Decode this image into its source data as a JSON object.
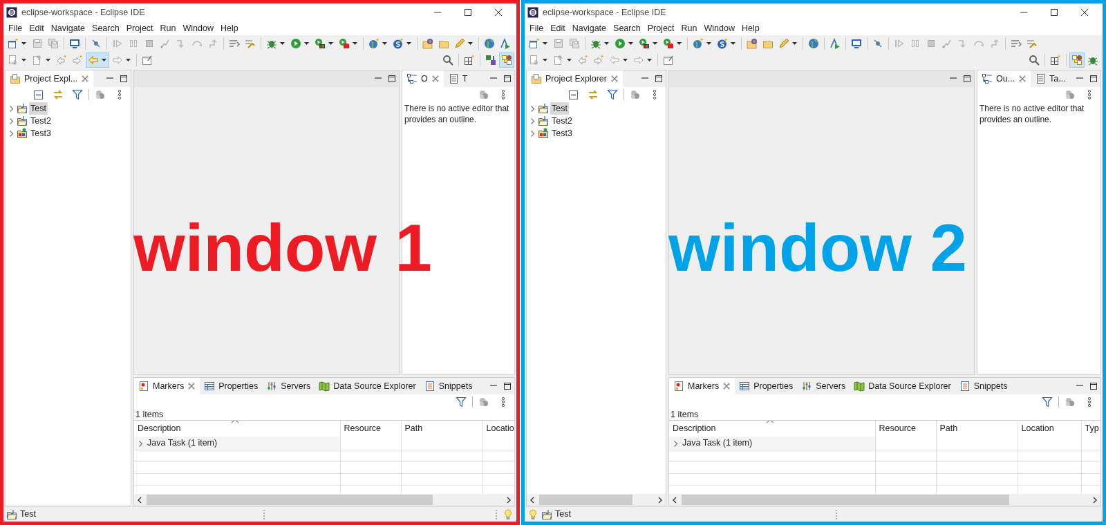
{
  "windows": [
    {
      "color": "#ed1c24",
      "title": "eclipse-workspace - Eclipse IDE",
      "menu": [
        "File",
        "Edit",
        "Navigate",
        "Search",
        "Project",
        "Run",
        "Window",
        "Help"
      ],
      "toolbar_rows": [
        [
          {
            "kind": "new",
            "menu": true,
            "pressed": false
          },
          {
            "kind": "save",
            "menu": false,
            "pressed": false
          },
          {
            "kind": "saveall",
            "menu": false,
            "pressed": false
          },
          {
            "kind": "separator"
          },
          {
            "kind": "monitor",
            "menu": false,
            "pressed": false
          },
          {
            "kind": "separator"
          },
          {
            "kind": "skip",
            "menu": false,
            "pressed": false
          },
          {
            "kind": "separator"
          },
          {
            "kind": "resume",
            "menu": false,
            "pressed": false
          },
          {
            "kind": "suspend",
            "menu": false,
            "pressed": false
          },
          {
            "kind": "stop",
            "menu": false,
            "pressed": false
          },
          {
            "kind": "disconnect",
            "menu": false,
            "pressed": false
          },
          {
            "kind": "stepinto",
            "menu": false,
            "pressed": false
          },
          {
            "kind": "stepover",
            "menu": false,
            "pressed": false
          },
          {
            "kind": "stepreturn",
            "menu": false,
            "pressed": false
          },
          {
            "kind": "separator"
          },
          {
            "kind": "wrap",
            "menu": false,
            "pressed": false
          },
          {
            "kind": "dropframe",
            "menu": false,
            "pressed": false
          },
          {
            "kind": "separator"
          },
          {
            "kind": "bug",
            "menu": true,
            "pressed": false
          },
          {
            "kind": "run",
            "menu": true,
            "pressed": false
          },
          {
            "kind": "coverage",
            "menu": true,
            "pressed": false
          },
          {
            "kind": "tools",
            "menu": true,
            "pressed": false
          },
          {
            "kind": "separator"
          },
          {
            "kind": "newproj",
            "menu": true,
            "pressed": false
          },
          {
            "kind": "newserver",
            "menu": true,
            "pressed": false
          },
          {
            "kind": "separator"
          },
          {
            "kind": "folderglobe",
            "menu": false,
            "pressed": false
          },
          {
            "kind": "folder",
            "menu": false,
            "pressed": false
          },
          {
            "kind": "pencil",
            "menu": true,
            "pressed": false
          },
          {
            "kind": "separator"
          },
          {
            "kind": "globe",
            "menu": false,
            "pressed": false
          },
          {
            "kind": "runweb",
            "menu": false,
            "pressed": false
          }
        ],
        [
          {
            "kind": "annotdown",
            "menu": true,
            "pressed": false
          },
          {
            "kind": "annotup",
            "menu": true,
            "pressed": false
          },
          {
            "kind": "backedit",
            "menu": false,
            "pressed": false
          },
          {
            "kind": "fwdedit",
            "menu": false,
            "pressed": false
          },
          {
            "kind": "back-active",
            "menu": true,
            "pressed": true
          },
          {
            "kind": "forward",
            "menu": true,
            "pressed": false
          },
          {
            "kind": "separator"
          },
          {
            "kind": "pin",
            "menu": false,
            "pressed": false
          },
          {
            "kind": "spacer"
          },
          {
            "kind": "search",
            "menu": false,
            "pressed": false
          },
          {
            "kind": "separator"
          },
          {
            "kind": "openpersp",
            "menu": false,
            "pressed": false
          },
          {
            "kind": "separator"
          },
          {
            "kind": "javapersp",
            "menu": false,
            "pressed": false
          },
          {
            "kind": "eepersp",
            "menu": false,
            "pressed": true
          }
        ]
      ],
      "explorer": {
        "tabs": [
          {
            "label": "Project Expl...",
            "selected": true
          }
        ],
        "horizontal_scrollbar": false,
        "items": [
          {
            "label": "Test",
            "kind": "project",
            "selected": true,
            "expanded": false
          },
          {
            "label": "Test2",
            "kind": "project",
            "selected": false,
            "expanded": false
          },
          {
            "label": "Test3",
            "kind": "web-project",
            "selected": false,
            "expanded": false
          }
        ]
      },
      "outline": {
        "tabs": [
          {
            "label": "O",
            "kind": "outline",
            "selected": true
          },
          {
            "label": "T",
            "kind": "tasks",
            "selected": false
          }
        ],
        "message": "There is no active editor that provides an outline."
      },
      "overlay_label": {
        "text": "window 1",
        "color": "#ed1c24"
      },
      "markers": {
        "tabs": [
          {
            "label": "Markers",
            "kind": "markers",
            "selected": true
          },
          {
            "label": "Properties",
            "kind": "properties",
            "selected": false
          },
          {
            "label": "Servers",
            "kind": "servers",
            "selected": false
          },
          {
            "label": "Data Source Explorer",
            "kind": "datasource",
            "selected": false
          },
          {
            "label": "Snippets",
            "kind": "snippets",
            "selected": false
          }
        ],
        "count": "1 items",
        "columns": [
          "Description",
          "Resource",
          "Path",
          "Locatio"
        ],
        "rows": [
          {
            "description": "Java Task (1 item)",
            "expanded": false
          }
        ]
      },
      "status_bar": {
        "text": "Test",
        "lightbulb_first": false
      }
    },
    {
      "color": "#00a2e8",
      "title": "eclipse-workspace - Eclipse IDE",
      "menu": [
        "File",
        "Edit",
        "Navigate",
        "Search",
        "Project",
        "Run",
        "Window",
        "Help"
      ],
      "toolbar_rows": [
        [
          {
            "kind": "new",
            "menu": true,
            "pressed": false
          },
          {
            "kind": "save",
            "menu": false,
            "pressed": false
          },
          {
            "kind": "saveall",
            "menu": false,
            "pressed": false
          },
          {
            "kind": "separator"
          },
          {
            "kind": "bug",
            "menu": true,
            "pressed": false
          },
          {
            "kind": "run",
            "menu": true,
            "pressed": false
          },
          {
            "kind": "coverage",
            "menu": true,
            "pressed": false
          },
          {
            "kind": "tools",
            "menu": true,
            "pressed": false
          },
          {
            "kind": "separator"
          },
          {
            "kind": "newproj",
            "menu": true,
            "pressed": false
          },
          {
            "kind": "newserver",
            "menu": true,
            "pressed": false
          },
          {
            "kind": "separator"
          },
          {
            "kind": "folderglobe",
            "menu": false,
            "pressed": false
          },
          {
            "kind": "folder",
            "menu": false,
            "pressed": false
          },
          {
            "kind": "pencil",
            "menu": true,
            "pressed": false
          },
          {
            "kind": "separator"
          },
          {
            "kind": "globe",
            "menu": false,
            "pressed": false
          },
          {
            "kind": "separator"
          },
          {
            "kind": "runweb",
            "menu": false,
            "pressed": false
          },
          {
            "kind": "separator"
          },
          {
            "kind": "monitor",
            "menu": false,
            "pressed": false
          },
          {
            "kind": "separator"
          },
          {
            "kind": "skip",
            "menu": false,
            "pressed": false
          },
          {
            "kind": "separator"
          },
          {
            "kind": "resume",
            "menu": false,
            "pressed": false
          },
          {
            "kind": "suspend",
            "menu": false,
            "pressed": false
          },
          {
            "kind": "stop",
            "menu": false,
            "pressed": false
          },
          {
            "kind": "disconnect",
            "menu": false,
            "pressed": false
          },
          {
            "kind": "stepinto",
            "menu": false,
            "pressed": false
          },
          {
            "kind": "stepover",
            "menu": false,
            "pressed": false
          },
          {
            "kind": "stepreturn",
            "menu": false,
            "pressed": false
          },
          {
            "kind": "separator"
          },
          {
            "kind": "wrap",
            "menu": false,
            "pressed": false
          },
          {
            "kind": "dropframe",
            "menu": false,
            "pressed": false
          }
        ],
        [
          {
            "kind": "annotdown",
            "menu": true,
            "pressed": false
          },
          {
            "kind": "annotup",
            "menu": true,
            "pressed": false
          },
          {
            "kind": "backedit",
            "menu": false,
            "pressed": false
          },
          {
            "kind": "fwdedit",
            "menu": false,
            "pressed": false
          },
          {
            "kind": "back",
            "menu": true,
            "pressed": false
          },
          {
            "kind": "forward",
            "menu": true,
            "pressed": false
          },
          {
            "kind": "separator"
          },
          {
            "kind": "pin",
            "menu": false,
            "pressed": false
          },
          {
            "kind": "spacer"
          },
          {
            "kind": "search",
            "menu": false,
            "pressed": false
          },
          {
            "kind": "separator"
          },
          {
            "kind": "openpersp",
            "menu": false,
            "pressed": false
          },
          {
            "kind": "separator"
          },
          {
            "kind": "eepersp",
            "menu": false,
            "pressed": true
          },
          {
            "kind": "bug",
            "menu": false,
            "pressed": false
          }
        ]
      ],
      "explorer": {
        "tabs": [
          {
            "label": "Project Explorer",
            "selected": true
          }
        ],
        "horizontal_scrollbar": true,
        "items": [
          {
            "label": "Test",
            "kind": "project",
            "selected": true,
            "expanded": false
          },
          {
            "label": "Test2",
            "kind": "project",
            "selected": false,
            "expanded": false
          },
          {
            "label": "Test3",
            "kind": "web-project",
            "selected": false,
            "expanded": false
          }
        ]
      },
      "outline": {
        "tabs": [
          {
            "label": "Ou...",
            "kind": "outline",
            "selected": true
          },
          {
            "label": "Ta...",
            "kind": "tasks",
            "selected": false
          }
        ],
        "message": "There is no active editor that provides an outline."
      },
      "overlay_label": {
        "text": "window 2",
        "color": "#00a2e8"
      },
      "markers": {
        "tabs": [
          {
            "label": "Markers",
            "kind": "markers",
            "selected": true
          },
          {
            "label": "Properties",
            "kind": "properties",
            "selected": false
          },
          {
            "label": "Servers",
            "kind": "servers",
            "selected": false
          },
          {
            "label": "Data Source Explorer",
            "kind": "datasource",
            "selected": false
          },
          {
            "label": "Snippets",
            "kind": "snippets",
            "selected": false
          }
        ],
        "count": "1 items",
        "columns": [
          "Description",
          "Resource",
          "Path",
          "Location",
          "Typ"
        ],
        "rows": [
          {
            "description": "Java Task (1 item)",
            "expanded": false
          }
        ]
      },
      "status_bar": {
        "text": "Test",
        "lightbulb_first": true
      }
    }
  ]
}
